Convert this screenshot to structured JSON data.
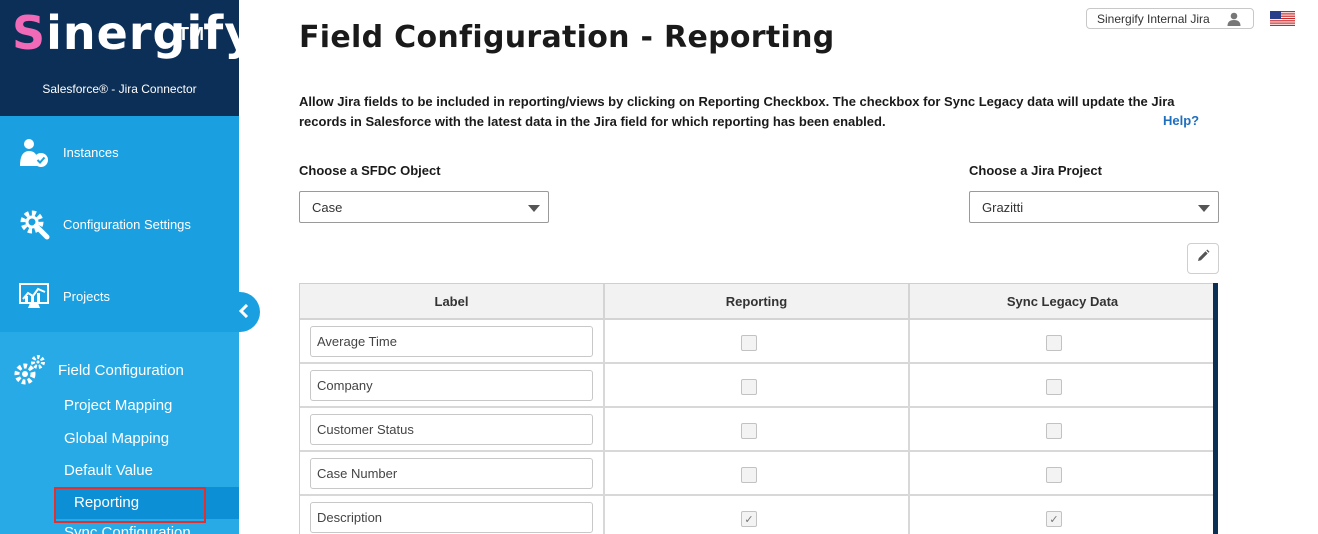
{
  "brand": {
    "name_first": "S",
    "name_rest": "inergify",
    "trademark": "TM",
    "tagline": "Salesforce® - Jira Connector"
  },
  "nav": {
    "instances": "Instances",
    "configuration_settings": "Configuration Settings",
    "projects": "Projects",
    "field_configuration": "Field Configuration",
    "sub_items": [
      "Project Mapping",
      "Global Mapping",
      "Default Value",
      "Reporting",
      "Sync Configuration"
    ]
  },
  "header": {
    "title": "Field Configuration - Reporting",
    "instance_name": "Sinergify Internal Jira"
  },
  "description": "Allow Jira fields to be included in reporting/views by clicking on Reporting Checkbox. The checkbox for Sync Legacy data will update the Jira records in Salesforce with the latest data in the Jira field for which reporting has been enabled.",
  "help_link": "Help?",
  "sfdc_object": {
    "label": "Choose a SFDC Object",
    "value": "Case"
  },
  "jira_project": {
    "label": "Choose a Jira Project",
    "value": "Grazitti"
  },
  "table": {
    "headers": [
      "Label",
      "Reporting",
      "Sync Legacy Data"
    ],
    "rows": [
      {
        "label": "Average Time",
        "reporting": false,
        "sync": false
      },
      {
        "label": "Company",
        "reporting": false,
        "sync": false
      },
      {
        "label": "Customer Status",
        "reporting": false,
        "sync": false
      },
      {
        "label": "Case Number",
        "reporting": false,
        "sync": false
      },
      {
        "label": "Description",
        "reporting": true,
        "sync": true
      }
    ]
  },
  "colors": {
    "sidebar": "#1aa0e0",
    "brand_bg": "#0b2f57",
    "active_highlight": "#e03030",
    "help_link": "#1f6fbf"
  },
  "icons": [
    "user-check-icon",
    "gear-wrench-icon",
    "chart-monitor-icon",
    "gears-icon",
    "chevron-left-icon",
    "user-icon",
    "us-flag-icon",
    "pencil-icon",
    "caret-down-icon"
  ]
}
